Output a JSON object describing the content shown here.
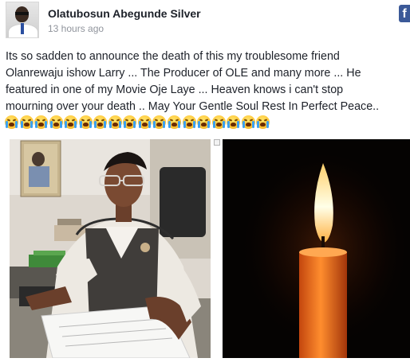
{
  "post": {
    "author": "Olatubosun Abegunde Silver",
    "timestamp": "13 hours ago",
    "text_lines": [
      "Its so sadden to announce the death of this my troublesome friend",
      "Olanrewaju ishow Larry ... The Producer of OLE and many more ... He",
      "featured in one of my Movie Oje Laye ... Heaven knows i can't stop",
      "mourning over your death .. May Your Gentle Soul Rest In Perfect Peace.."
    ],
    "emoji_count": 18,
    "emoji_name": "loudly-crying-face"
  },
  "icons": {
    "facebook_logo": "facebook-f-icon",
    "facebook_letter": "f"
  },
  "photos": [
    {
      "name": "man-at-desk-photo",
      "subject": "man in patterned shirt and waistcoat at desk"
    },
    {
      "name": "candle-photo",
      "subject": "lit candle in darkness"
    }
  ],
  "colors": {
    "name": "#1d2129",
    "timestamp": "#90949c",
    "facebook_blue": "#3b5998"
  }
}
